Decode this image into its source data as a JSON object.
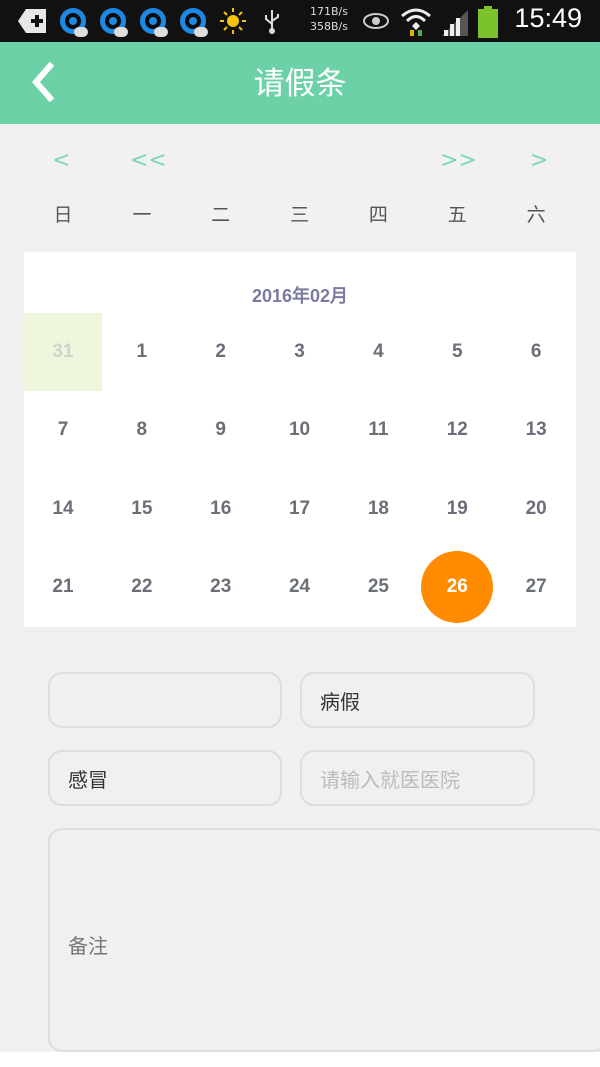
{
  "status_bar": {
    "rate_up": "171B/s",
    "rate_down": "358B/s",
    "time": "15:49"
  },
  "header": {
    "title": "请假条",
    "back_icon": "chevron-left-icon"
  },
  "calendar": {
    "nav": {
      "prev_month": "<",
      "prev_year": "<<",
      "next_year": ">>",
      "next_month": ">"
    },
    "weekdays": [
      "日",
      "一",
      "二",
      "三",
      "四",
      "五",
      "六"
    ],
    "month_label": "2016年02月",
    "weeks": [
      [
        "31",
        "1",
        "2",
        "3",
        "4",
        "5",
        "6"
      ],
      [
        "7",
        "8",
        "9",
        "10",
        "11",
        "12",
        "13"
      ],
      [
        "14",
        "15",
        "16",
        "17",
        "18",
        "19",
        "20"
      ],
      [
        "21",
        "22",
        "23",
        "24",
        "25",
        "26",
        "27"
      ]
    ],
    "selected_day": "26",
    "prev_month_day": "31",
    "accent_color": "#ff8c00"
  },
  "form": {
    "field_1_value": "",
    "leave_type_value": "病假",
    "reason_value": "感冒",
    "hospital_placeholder": "请输入就医医院",
    "notes_label": "备注"
  },
  "colors": {
    "header": "#6cd1a6",
    "selected_day": "#ff8c00",
    "prev_month_bg": "#eef6dc"
  }
}
